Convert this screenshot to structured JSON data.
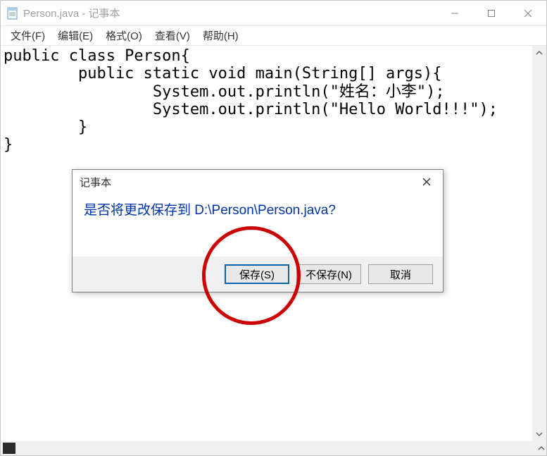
{
  "window": {
    "title": "Person.java - 记事本"
  },
  "menu": {
    "file": "文件(F)",
    "edit": "编辑(E)",
    "format": "格式(O)",
    "view": "查看(V)",
    "help": "帮助(H)"
  },
  "editor": {
    "content": "public class Person{\n        public static void main(String[] args){\n                System.out.println(\"姓名：小李\");\n                System.out.println(\"Hello World!!!\");\n        }\n}"
  },
  "dialog": {
    "title": "记事本",
    "message": "是否将更改保存到 D:\\Person\\Person.java?",
    "save": "保存(S)",
    "nosave": "不保存(N)",
    "cancel": "取消"
  }
}
